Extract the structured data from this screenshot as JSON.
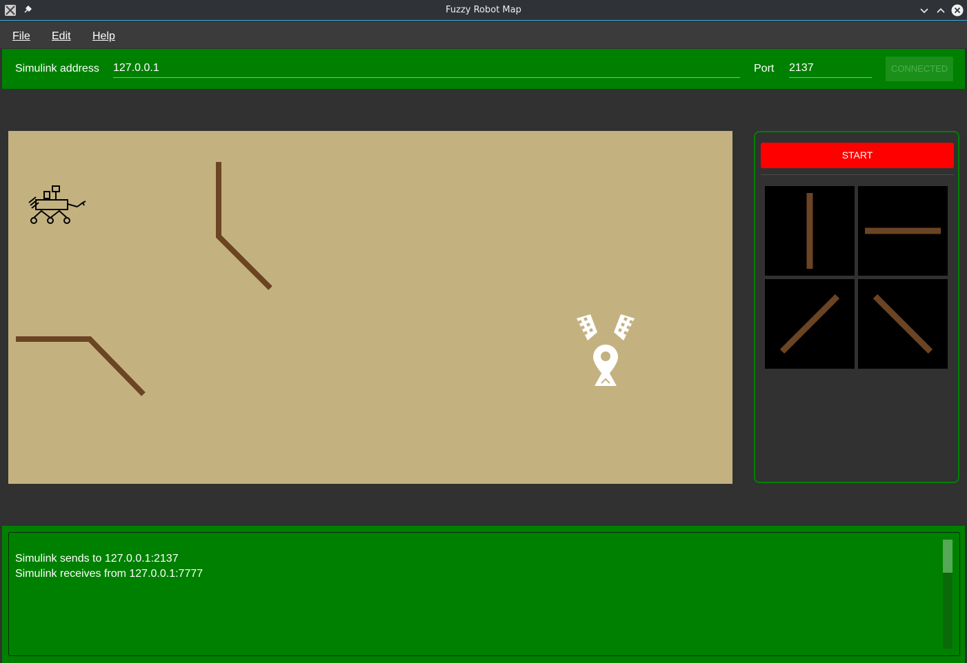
{
  "window": {
    "title": "Fuzzy Robot Map"
  },
  "menu": {
    "file": "File",
    "edit": "Edit",
    "help": "Help"
  },
  "connection": {
    "address_label": "Simulink address",
    "address_value": "127.0.0.1",
    "port_label": "Port",
    "port_value": "2137",
    "connect_button": "CONNECTED"
  },
  "panel": {
    "start_button": "START",
    "tiles": [
      "vertical-wall",
      "horizontal-wall",
      "diagonal-up-wall",
      "diagonal-down-wall"
    ]
  },
  "log": {
    "lines": [
      "Simulink sends to 127.0.0.1:2137",
      "Simulink receives from 127.0.0.1:7777"
    ]
  },
  "colors": {
    "accent_green": "#008000",
    "start_red": "#ff0000",
    "map_sand": "#c3b280",
    "wall_brown": "#6b4423"
  },
  "icons": {
    "robot": "rover-icon",
    "goal": "finish-flags-pin-icon"
  }
}
